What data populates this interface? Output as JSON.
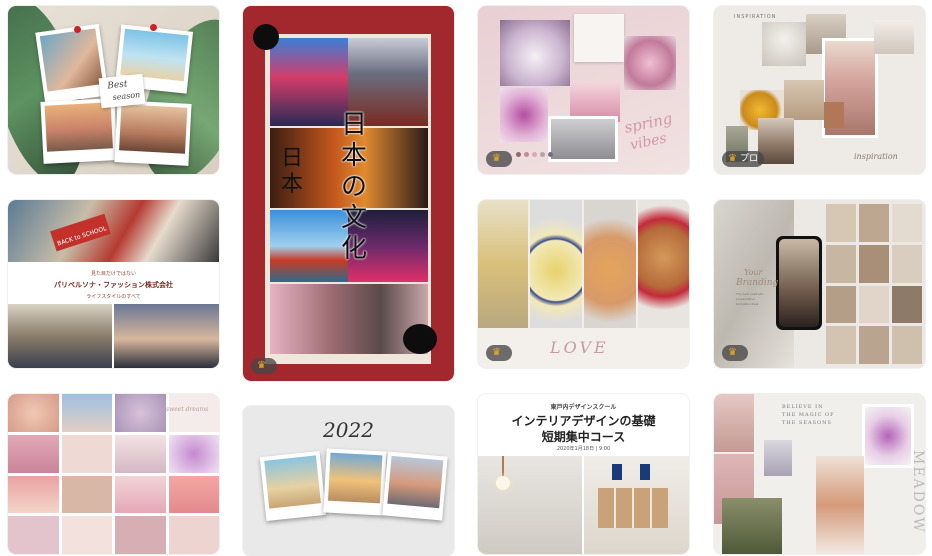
{
  "badges": {
    "crown": "♛",
    "pro": "プロ"
  },
  "cards": {
    "summer": {
      "caption_line1": "Best",
      "caption_line2": "season"
    },
    "japan": {
      "title_chars": [
        "日",
        "本",
        "の",
        "文",
        "化"
      ],
      "side_chars": [
        "日",
        "本"
      ]
    },
    "spring": {
      "script_line1": "spring",
      "script_line2": "vibes"
    },
    "inspiration": {
      "top_arc": "INSPIRATION",
      "script": "inspiration"
    },
    "fashion": {
      "tagline": "見た目だけではない",
      "company": "パリペルソナ・ファッション株式会社",
      "sub": "ライフスタイルのすべて",
      "sticker": "BACK to SCHOOL"
    },
    "food": {
      "script": "LOVE"
    },
    "branding": {
      "script_line1": "Your",
      "script_line2": "Branding",
      "small1": "The best aesthetic",
      "small2": "presentation",
      "small3": "template ideas"
    },
    "pastel": {
      "script": "sweet dreams"
    },
    "year": {
      "title": "2022"
    },
    "interior": {
      "school": "東戸内デザインスクール",
      "title1": "インテリアデザインの基礎",
      "title2": "短期集中コース",
      "date": "2020年1月18日 | 9:00"
    },
    "seasons": {
      "line1": "BELIEVE IN",
      "line2": "THE MAGIC OF",
      "line3": "THE SEASONS",
      "vertical": "MEADOW"
    }
  },
  "colors": {
    "japan_red": "#a3282e",
    "crown_gold": "#f2b01e"
  }
}
